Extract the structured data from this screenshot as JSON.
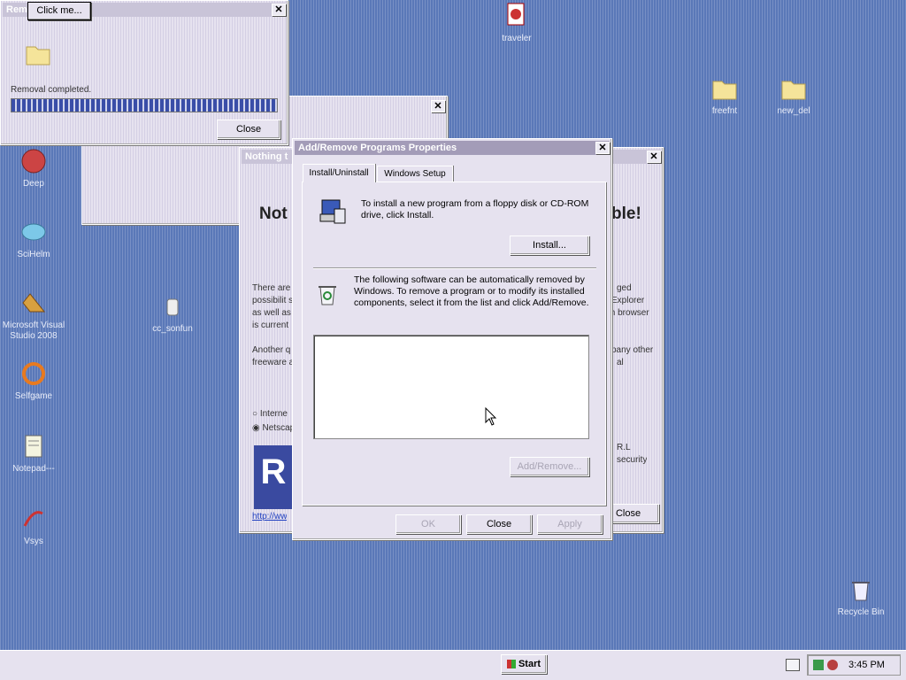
{
  "desktop": {
    "icons": [
      {
        "label": "traveler",
        "icon": "traveler-icon"
      },
      {
        "label": "freefnt",
        "icon": "folder-icon"
      },
      {
        "label": "new_del",
        "icon": "folder-icon"
      },
      {
        "label": "Deep",
        "icon": "app-icon"
      },
      {
        "label": "SciHelm",
        "icon": "app-icon"
      },
      {
        "label": "Microsoft Visual Studio 2008",
        "icon": "visual-studio-icon"
      },
      {
        "label": "Selfgame",
        "icon": "app-icon"
      },
      {
        "label": "Notepad---",
        "icon": "notepad-icon"
      },
      {
        "label": "Vsys",
        "icon": "app-icon"
      },
      {
        "label": "cc_sonfun",
        "icon": "app-icon"
      },
      {
        "label": "Recycle Bin",
        "icon": "recycle-bin-icon"
      }
    ]
  },
  "removal_window": {
    "title": "Remo",
    "click_me_label": "Click me...",
    "status_text": "Removal completed.",
    "progress": 1.0,
    "close_label": "Close"
  },
  "background_dialog": {
    "title": "Nothing t",
    "big_text_left": "Not",
    "big_text_right": "ble!",
    "para_lines": [
      "There are",
      "possibilit s",
      "as well as",
      "is current"
    ],
    "para2_lines": [
      "Another q",
      "freeware a"
    ],
    "radio_internet": "Interne",
    "radio_netscape": "Netscape",
    "link": "http://ww",
    "right_lines": [
      "ged",
      "Explorer",
      "th browser"
    ],
    "right_lines2": [
      "pany other",
      "al"
    ],
    "right_lines3": [
      "R.L",
      "security"
    ],
    "close_label": "Close"
  },
  "addremove_dialog": {
    "title": "Add/Remove Programs Properties",
    "tabs": [
      "Install/Uninstall",
      "Windows Setup"
    ],
    "install_text": "To install a new program from a floppy disk or CD-ROM drive, click Install.",
    "install_button": "Install...",
    "remove_text": "The following software can be automatically removed by Windows. To remove a program or to modify its installed components, select it from the list and click Add/Remove.",
    "addremove_button": "Add/Remove...",
    "ok_button": "OK",
    "close_button": "Close",
    "apply_button": "Apply"
  },
  "taskbar": {
    "start_label": "Start",
    "clock": "3:45 PM"
  }
}
